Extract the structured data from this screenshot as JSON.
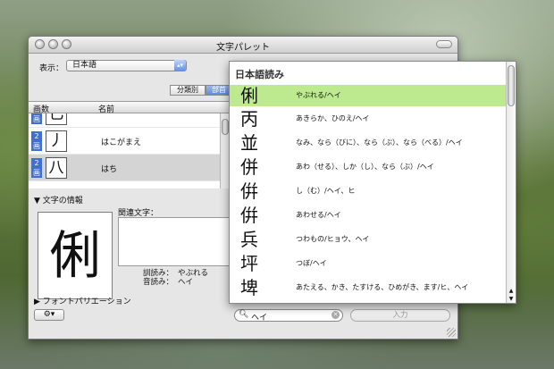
{
  "window": {
    "title": "文字パレット"
  },
  "toolbar": {
    "display_label": "表示：",
    "display_value": "日本語",
    "seg_tab1": "分類別",
    "seg_tab2": "部首"
  },
  "list": {
    "col_stroke": "画数",
    "col_name": "名前",
    "rows": [
      {
        "badge_num": "2",
        "badge_unit": "画",
        "char": "⼃",
        "name": "はこがまえ"
      },
      {
        "badge_num": "2",
        "badge_unit": "画",
        "char": "⼋",
        "name": "はち"
      }
    ]
  },
  "info": {
    "header": "文字の情報",
    "char": "俐",
    "related_label": "関連文字：",
    "kun_label": "訓読み：",
    "kun_value": "やぶれる",
    "on_label": "音読み：",
    "on_value": "ヘイ"
  },
  "font_variation": "フォントバリエーション",
  "search": {
    "value": "ヘイ"
  },
  "insert_label": "入力",
  "popup": {
    "title": "日本語読み",
    "items": [
      {
        "char": "俐",
        "reading": "やぶれる/ヘイ"
      },
      {
        "char": "丙",
        "reading": "あきらか、ひのえ/ヘイ"
      },
      {
        "char": "並",
        "reading": "なみ、なら（びに）、なら（ぶ）、なら（べる）/ヘイ"
      },
      {
        "char": "併",
        "reading": "あわ（せる）、しか（し）、なら（ぶ）/ヘイ"
      },
      {
        "char": "倂",
        "reading": "し（む）/ヘイ、ヒ"
      },
      {
        "char": "倂",
        "reading": "あわせる/ヘイ"
      },
      {
        "char": "兵",
        "reading": "つわもの/ヒョウ、ヘイ"
      },
      {
        "char": "坪",
        "reading": "つぼ/ヘイ"
      },
      {
        "char": "埤",
        "reading": "あたえる、かき、たすける、ひめがき、ます/ヒ、ヘイ"
      }
    ]
  }
}
